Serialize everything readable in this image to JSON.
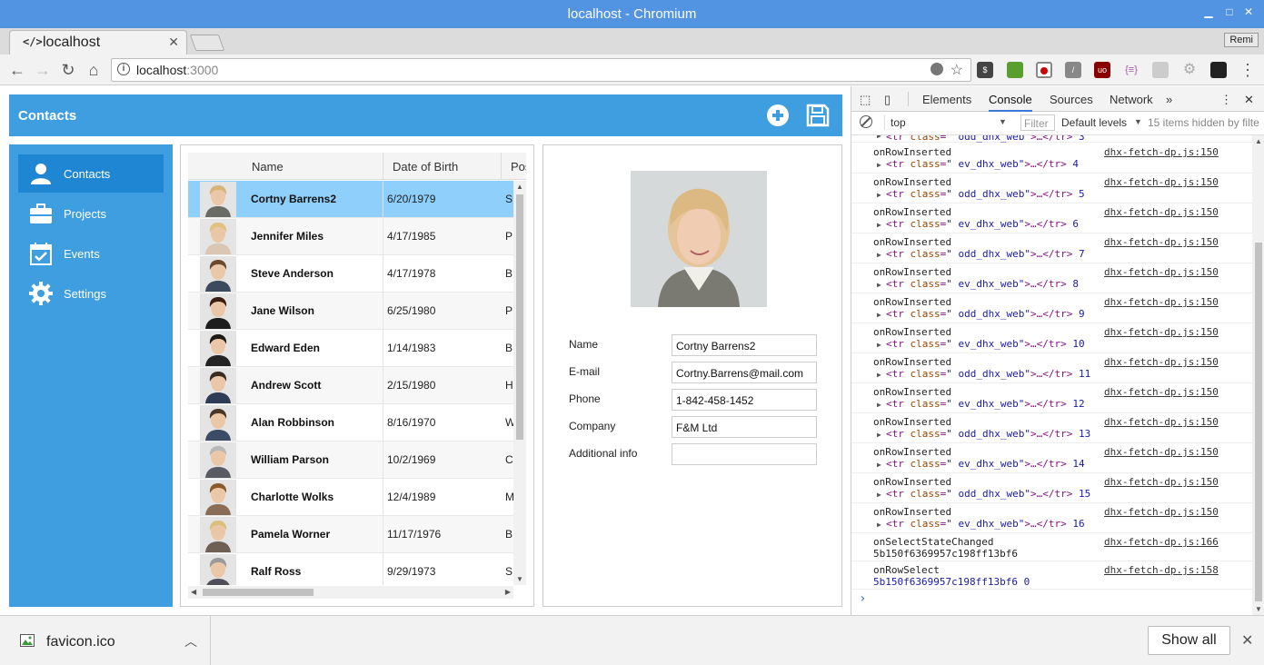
{
  "window": {
    "title": "localhost - Chromium"
  },
  "tab": {
    "label": "localhost",
    "icon": "code-icon",
    "code_glyph": "</>"
  },
  "profile": {
    "label": "Remi"
  },
  "omnibox": {
    "host": "localhost",
    "port": ":3000"
  },
  "app": {
    "header_title": "Contacts",
    "sidebar": [
      {
        "label": "Contacts",
        "icon": "person-icon",
        "active": true
      },
      {
        "label": "Projects",
        "icon": "briefcase-icon",
        "active": false
      },
      {
        "label": "Events",
        "icon": "calendar-icon",
        "active": false
      },
      {
        "label": "Settings",
        "icon": "gear-icon",
        "active": false
      }
    ],
    "grid": {
      "columns": [
        "Name",
        "Date of Birth",
        "Pos"
      ],
      "rows": [
        {
          "name": "Cortny Barrens2",
          "dob": "6/20/1979",
          "pos": "S"
        },
        {
          "name": "Jennifer Miles",
          "dob": "4/17/1985",
          "pos": "P"
        },
        {
          "name": "Steve Anderson",
          "dob": "4/17/1978",
          "pos": "B"
        },
        {
          "name": "Jane Wilson",
          "dob": "6/25/1980",
          "pos": "P"
        },
        {
          "name": "Edward Eden",
          "dob": "1/14/1983",
          "pos": "B"
        },
        {
          "name": "Andrew Scott",
          "dob": "2/15/1980",
          "pos": "H"
        },
        {
          "name": "Alan Robbinson",
          "dob": "8/16/1970",
          "pos": "W"
        },
        {
          "name": "William Parson",
          "dob": "10/2/1969",
          "pos": "C"
        },
        {
          "name": "Charlotte Wolks",
          "dob": "12/4/1989",
          "pos": "M"
        },
        {
          "name": "Pamela Worner",
          "dob": "11/17/1976",
          "pos": "B"
        },
        {
          "name": "Ralf Ross",
          "dob": "9/29/1973",
          "pos": "S"
        }
      ]
    },
    "form": {
      "fields": [
        {
          "label": "Name",
          "value": "Cortny Barrens2"
        },
        {
          "label": "E-mail",
          "value": "Cortny.Barrens@mail.com"
        },
        {
          "label": "Phone",
          "value": "1-842-458-1452"
        },
        {
          "label": "Company",
          "value": "F&M Ltd"
        },
        {
          "label": "Additional info",
          "value": ""
        }
      ]
    }
  },
  "devtools": {
    "tabs": [
      "Elements",
      "Console",
      "Sources",
      "Network",
      "»"
    ],
    "active_tab": "Console",
    "context": "top",
    "filter_placeholder": "Filter",
    "levels": "Default levels",
    "hidden_info": "15 items hidden by filte",
    "partial_first": {
      "cls": "odd_dhx_web",
      "num": "3"
    },
    "entries": [
      {
        "msg": "onRowInserted",
        "src": "dhx-fetch-dp.js:150",
        "cls": "ev_dhx_web",
        "num": "4"
      },
      {
        "msg": "onRowInserted",
        "src": "dhx-fetch-dp.js:150",
        "cls": "odd_dhx_web",
        "num": "5"
      },
      {
        "msg": "onRowInserted",
        "src": "dhx-fetch-dp.js:150",
        "cls": "ev_dhx_web",
        "num": "6"
      },
      {
        "msg": "onRowInserted",
        "src": "dhx-fetch-dp.js:150",
        "cls": "odd_dhx_web",
        "num": "7"
      },
      {
        "msg": "onRowInserted",
        "src": "dhx-fetch-dp.js:150",
        "cls": "ev_dhx_web",
        "num": "8"
      },
      {
        "msg": "onRowInserted",
        "src": "dhx-fetch-dp.js:150",
        "cls": "odd_dhx_web",
        "num": "9"
      },
      {
        "msg": "onRowInserted",
        "src": "dhx-fetch-dp.js:150",
        "cls": "ev_dhx_web",
        "num": "10"
      },
      {
        "msg": "onRowInserted",
        "src": "dhx-fetch-dp.js:150",
        "cls": "odd_dhx_web",
        "num": "11"
      },
      {
        "msg": "onRowInserted",
        "src": "dhx-fetch-dp.js:150",
        "cls": "ev_dhx_web",
        "num": "12"
      },
      {
        "msg": "onRowInserted",
        "src": "dhx-fetch-dp.js:150",
        "cls": "odd_dhx_web",
        "num": "13"
      },
      {
        "msg": "onRowInserted",
        "src": "dhx-fetch-dp.js:150",
        "cls": "ev_dhx_web",
        "num": "14"
      },
      {
        "msg": "onRowInserted",
        "src": "dhx-fetch-dp.js:150",
        "cls": "odd_dhx_web",
        "num": "15"
      },
      {
        "msg": "onRowInserted",
        "src": "dhx-fetch-dp.js:150",
        "cls": "ev_dhx_web",
        "num": "16"
      }
    ],
    "select_state": {
      "msg": "onSelectStateChanged",
      "id": "5b150f6369957c198ff13bf6",
      "src": "dhx-fetch-dp.js:166"
    },
    "row_select": {
      "msg": "onRowSelect",
      "id": "5b150f6369957c198ff13bf6 0",
      "src": "dhx-fetch-dp.js:158"
    },
    "prompt": "›"
  },
  "downloads": {
    "file": "favicon.ico",
    "show_all": "Show all"
  }
}
